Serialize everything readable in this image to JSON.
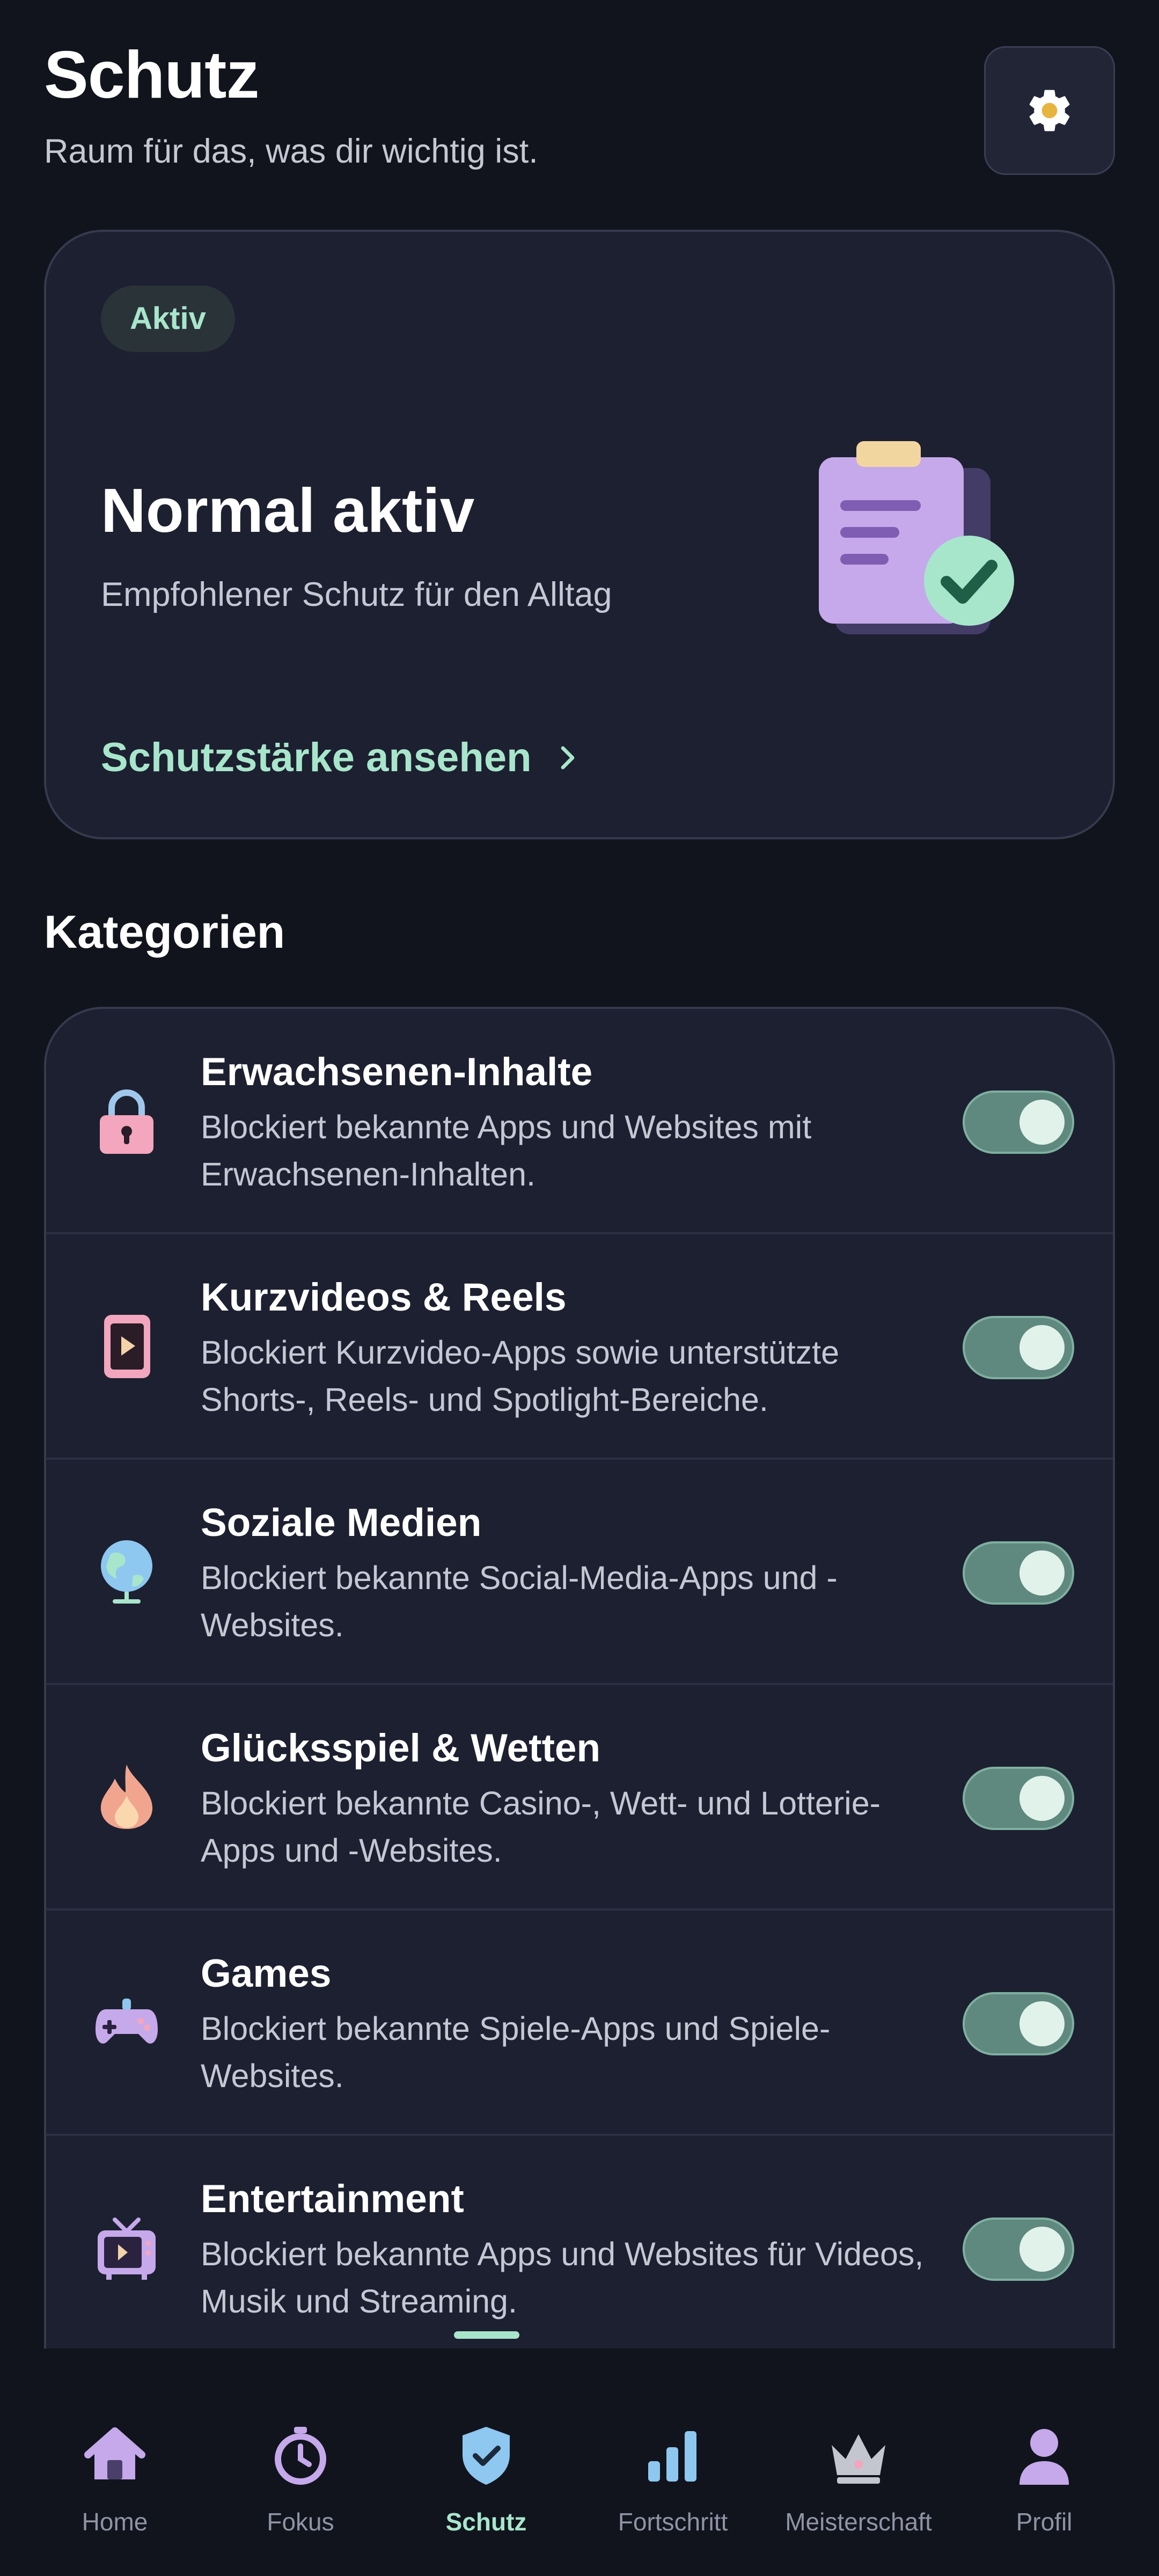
{
  "header": {
    "title": "Schutz",
    "subtitle": "Raum für das, was dir wichtig ist."
  },
  "status_card": {
    "badge": "Aktiv",
    "mode_title": "Normal aktiv",
    "mode_description": "Empfohlener Schutz für den Alltag",
    "link_label": "Schutzstärke ansehen"
  },
  "categories": {
    "title": "Kategorien",
    "items": [
      {
        "title": "Erwachsenen-Inhalte",
        "description": "Blockiert bekannte Apps und Websites mit Erwachsenen-Inhalten.",
        "enabled": true,
        "icon": "lock-icon"
      },
      {
        "title": "Kurzvideos & Reels",
        "description": "Blockiert Kurzvideo-Apps sowie unterstützte Shorts-, Reels- und Spotlight-Bereiche.",
        "enabled": true,
        "icon": "phone-video-icon"
      },
      {
        "title": "Soziale Medien",
        "description": "Blockiert bekannte Social-Media-Apps und -Websites.",
        "enabled": true,
        "icon": "globe-icon"
      },
      {
        "title": "Glücksspiel & Wetten",
        "description": "Blockiert bekannte Casino-, Wett- und Lotterie-Apps und -Websites.",
        "enabled": true,
        "icon": "flame-icon"
      },
      {
        "title": "Games",
        "description": "Blockiert bekannte Spiele-Apps und Spiele-Websites.",
        "enabled": true,
        "icon": "gamepad-icon"
      },
      {
        "title": "Entertainment",
        "description": "Blockiert bekannte Apps und Websites für Videos, Musik und Streaming.",
        "enabled": true,
        "icon": "tv-icon"
      }
    ]
  },
  "nav": {
    "items": [
      {
        "label": "Home",
        "icon": "home-icon",
        "active": false
      },
      {
        "label": "Fokus",
        "icon": "stopwatch-icon",
        "active": false
      },
      {
        "label": "Schutz",
        "icon": "shield-icon",
        "active": true
      },
      {
        "label": "Fortschritt",
        "icon": "bar-chart-icon",
        "active": false
      },
      {
        "label": "Meisterschaft",
        "icon": "crown-icon",
        "active": false
      },
      {
        "label": "Profil",
        "icon": "person-icon",
        "active": false
      }
    ]
  },
  "colors": {
    "background": "#11141d",
    "card": "#1d2030",
    "accent": "#a8e6cc",
    "toggle_on": "#5f887e"
  }
}
